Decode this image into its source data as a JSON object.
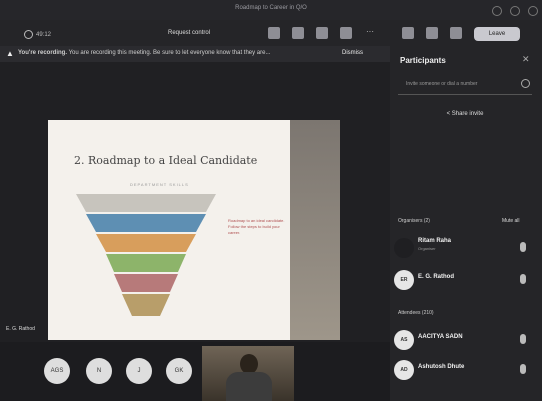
{
  "window": {
    "title": "Roadmap to Career in Q/O"
  },
  "toolbar": {
    "timer": "49:12",
    "request_control": "Request control",
    "leave_label": "Leave",
    "icon_names": [
      "people-icon",
      "chat-icon",
      "hand-icon",
      "view-icon",
      "more-icon",
      "camera-icon",
      "mic-icon",
      "share-icon"
    ]
  },
  "banner": {
    "label": "You're recording.",
    "message": "You are recording this meeting. Be sure to let everyone know that they are...",
    "dismiss": "Dismiss"
  },
  "slide": {
    "title": "2. Roadmap to a Ideal Candidate",
    "subhead": "DEPARTMENT SKILLS",
    "notes": "Roadmap to an ideal candidate. Follow the steps to build your career."
  },
  "presenter": {
    "name": "E. G. Rathod"
  },
  "bottom_avatars": [
    "AGS",
    "N",
    "J",
    "GK"
  ],
  "participants": {
    "title": "Participants",
    "search_placeholder": "Invite someone or dial a number",
    "share_invite": "Share invite",
    "organisers_label": "Organisers (2)",
    "mute_all": "Mute all",
    "attendees_label": "Attendees (210)",
    "people": [
      {
        "initials": "",
        "name": "Ritam Raha",
        "role": "Organiser",
        "section": "organisers"
      },
      {
        "initials": "ER",
        "name": "E. G. Rathod",
        "role": "",
        "section": "organisers"
      },
      {
        "initials": "AS",
        "name": "AACITYA SADN",
        "role": "",
        "section": "attendees"
      },
      {
        "initials": "AD",
        "name": "Ashutosh Dhute",
        "role": "",
        "section": "attendees"
      }
    ]
  },
  "colors": {
    "background": "#1f1f22",
    "panel": "#252528",
    "slide": "#f4f1ec"
  }
}
